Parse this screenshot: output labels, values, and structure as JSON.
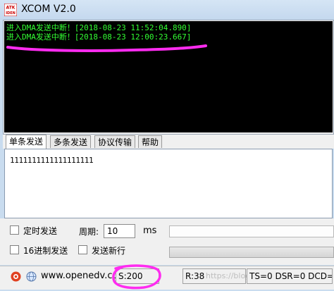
{
  "window": {
    "title": "XCOM V2.0",
    "logo_text": [
      "ATK",
      "IDEN"
    ]
  },
  "receive": {
    "lines": [
      "进入DMA发送中断！[2018-08-23 11:52:04.890]",
      "进入DMA发送中断！[2018-08-23 12:00:23.667]"
    ]
  },
  "tabs": [
    {
      "label": "单条发送",
      "active": true
    },
    {
      "label": "多条发送",
      "active": false
    },
    {
      "label": "协议传输",
      "active": false
    },
    {
      "label": "帮助",
      "active": false
    }
  ],
  "send": {
    "text": "1111111111111111111"
  },
  "controls": {
    "timed_send_label": "定时发送",
    "timed_send_checked": false,
    "period_label": "周期:",
    "period_value": "10",
    "period_unit": "ms",
    "hex_send_label": "16进制发送",
    "hex_send_checked": false,
    "newline_label": "发送新行",
    "newline_checked": false
  },
  "status": {
    "website": "www.openedv.co",
    "sent": "S:200",
    "received": "R:38",
    "watermark": "https://blog.csdn.net",
    "signals": "TS=0 DSR=0 DCD="
  },
  "colors": {
    "terminal_bg": "#000000",
    "terminal_text": "#33ff33",
    "annotation": "#ff2cf0"
  }
}
